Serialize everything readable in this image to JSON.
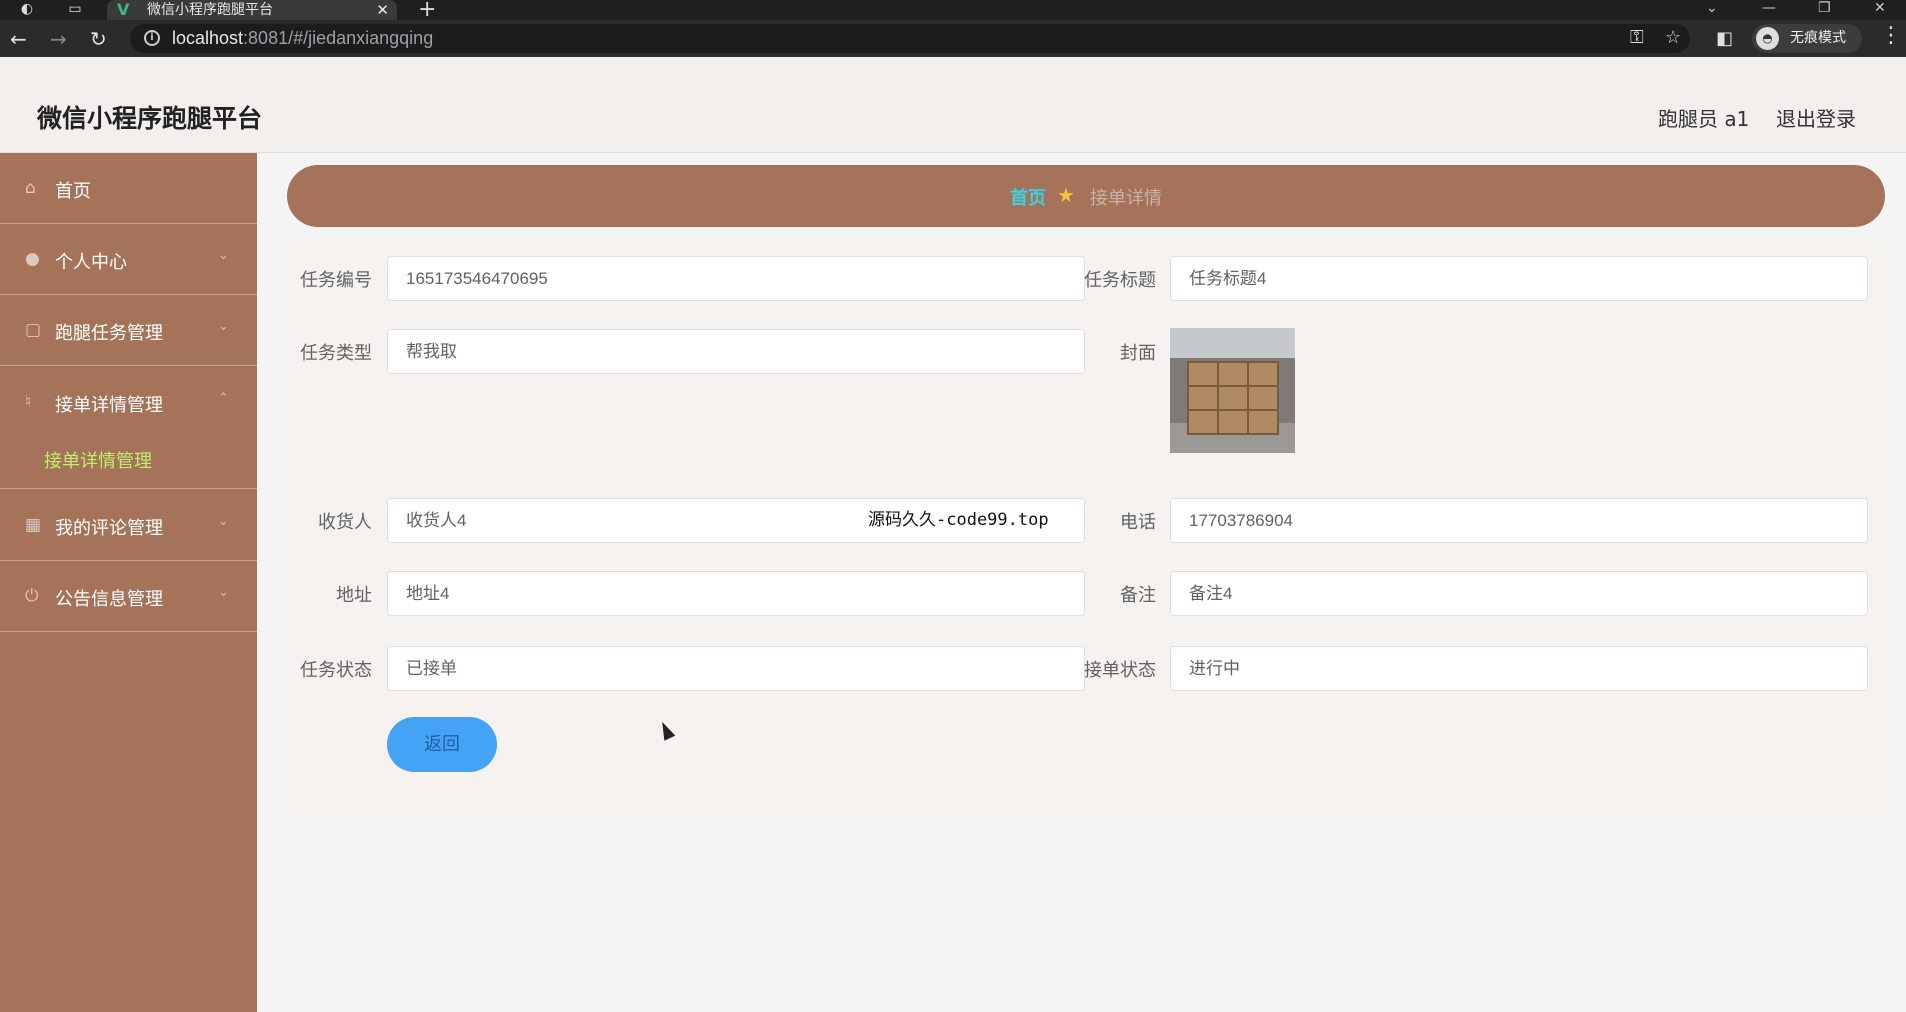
{
  "browser": {
    "tab_title": "微信小程序跑腿平台",
    "url_host": "localhost",
    "url_rest": ":8081/#/jiedanxiangqing",
    "incognito_label": "无痕模式"
  },
  "header": {
    "brand": "微信小程序跑腿平台",
    "user": "跑腿员 a1",
    "logout": "退出登录"
  },
  "sidebar": {
    "items": [
      {
        "label": "首页"
      },
      {
        "label": "个人中心"
      },
      {
        "label": "跑腿任务管理"
      },
      {
        "label": "接单详情管理"
      },
      {
        "label": "我的评论管理"
      },
      {
        "label": "公告信息管理"
      }
    ],
    "sub_active": "接单详情管理"
  },
  "breadcrumb": {
    "home": "首页",
    "current": "接单详情"
  },
  "form": {
    "task_no_label": "任务编号",
    "task_no": "165173546470695",
    "task_title_label": "任务标题",
    "task_title": "任务标题4",
    "task_type_label": "任务类型",
    "task_type": "帮我取",
    "cover_label": "封面",
    "receiver_label": "收货人",
    "receiver": "收货人4",
    "phone_label": "电话",
    "phone": "17703786904",
    "address_label": "地址",
    "address": "地址4",
    "remark_label": "备注",
    "remark": "备注4",
    "task_status_label": "任务状态",
    "task_status": "已接单",
    "order_status_label": "接单状态",
    "order_status": "进行中",
    "back_button": "返回"
  },
  "overlay_text": "源码久久-code99.top",
  "colors": {
    "sidebar_bg": "#a5735a",
    "active_sub": "#bff06b",
    "breadcrumb_home": "#3ed1e0",
    "button": "#45a3f5"
  }
}
